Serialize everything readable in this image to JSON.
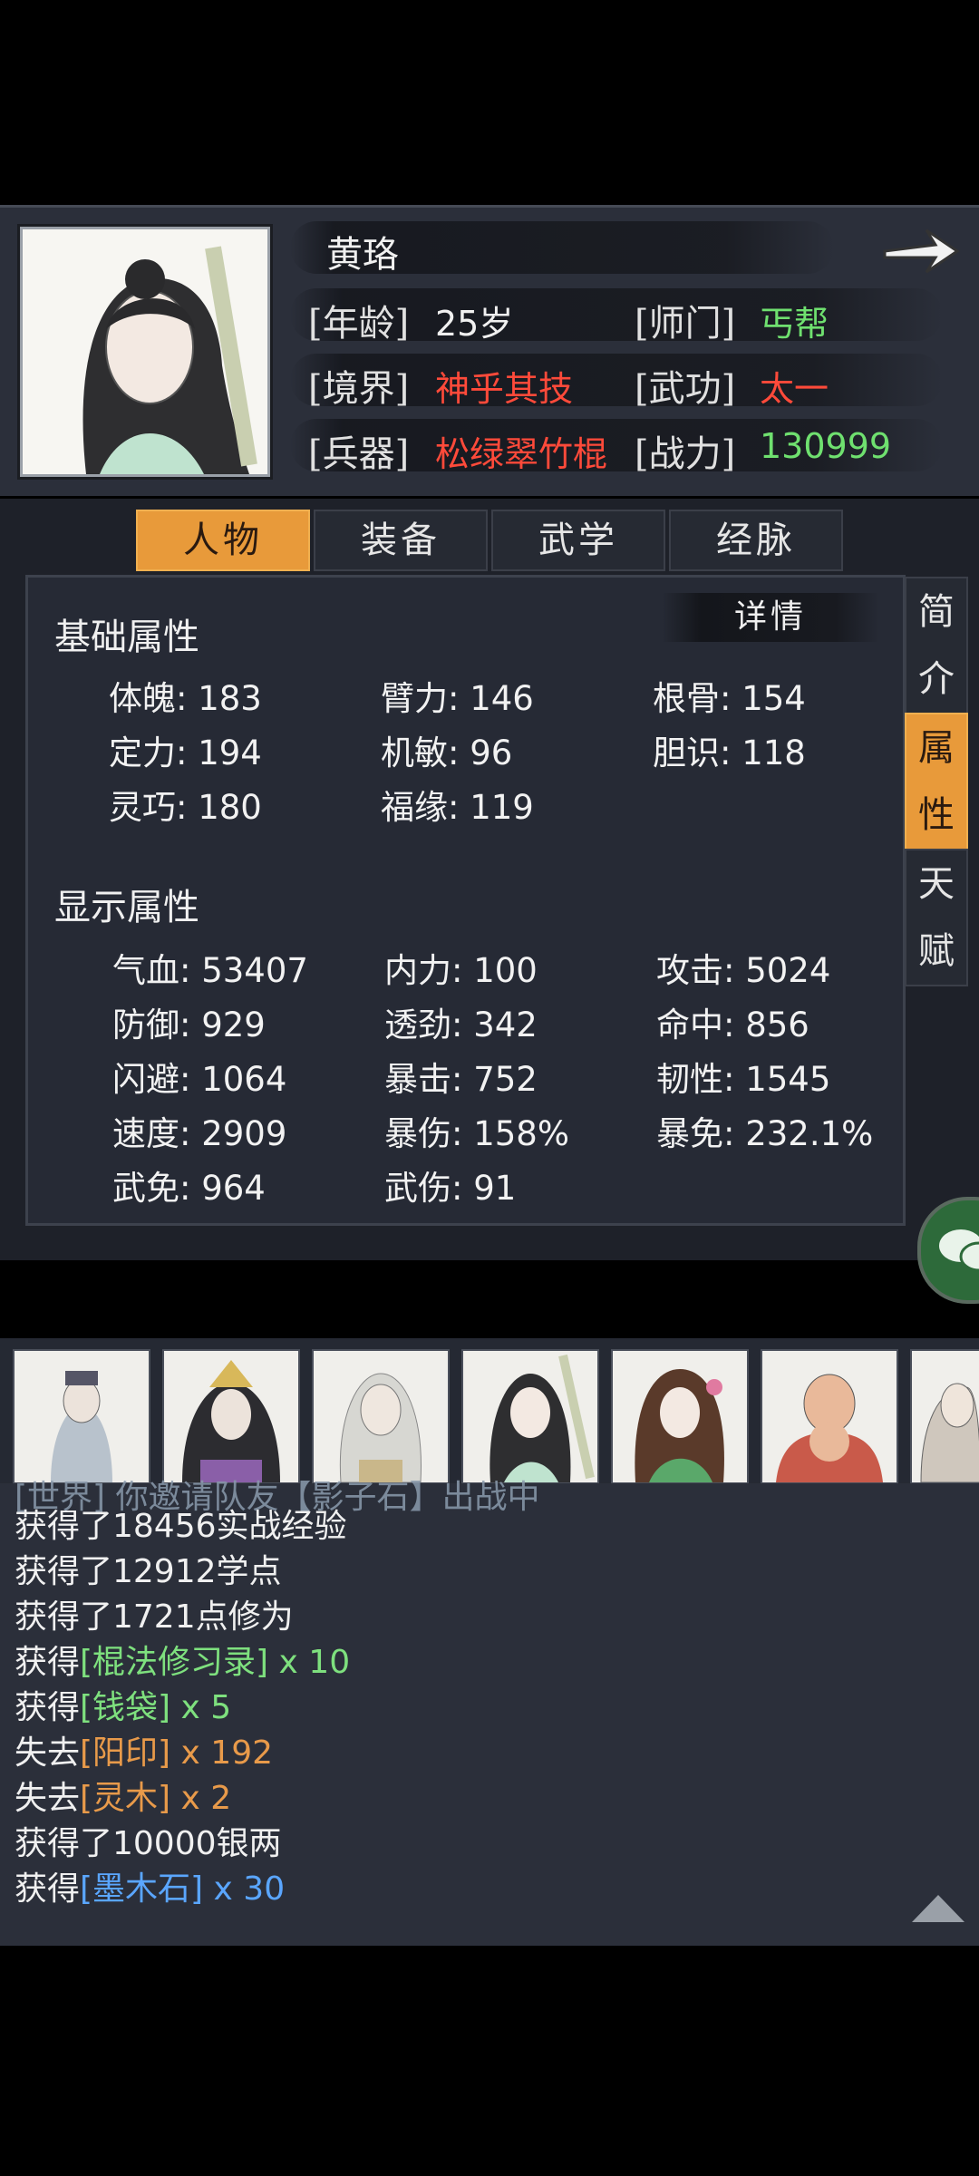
{
  "character": {
    "name": "黄珞",
    "rows": [
      {
        "l1": "[年龄]",
        "v1": "25岁",
        "l2": "[师门]",
        "v2": "丐帮"
      },
      {
        "l1": "[境界]",
        "v1": "神乎其技",
        "l2": "[武功]",
        "v2": "太一"
      },
      {
        "l1": "[兵器]",
        "v1": "松绿翠竹棍",
        "l2": "[战力]",
        "v2": "130999"
      }
    ]
  },
  "tabs": [
    "人物",
    "装备",
    "武学",
    "经脉"
  ],
  "side_tabs": [
    "简介",
    "属性",
    "天赋"
  ],
  "detail_label": "详情",
  "basic": {
    "title": "基础属性",
    "stats": [
      "体魄: 183",
      "臂力: 146",
      "根骨: 154",
      "定力: 194",
      "机敏: 96",
      "胆识: 118",
      "灵巧: 180",
      "福缘: 119"
    ]
  },
  "display": {
    "title": "显示属性",
    "stats": [
      "气血: 53407",
      "内力: 100",
      "攻击: 5024",
      "防御: 929",
      "透劲: 342",
      "命中: 856",
      "闪避: 1064",
      "暴击: 752",
      "韧性: 1545",
      "速度: 2909",
      "暴伤: 158%",
      "暴免: 232.1%",
      "武免: 964",
      "武伤: 91"
    ]
  },
  "log": {
    "partial": "[世界] 你邀请队友【影子石】出战中",
    "l1": "获得了18456实战经验",
    "l2": "获得了12912学点",
    "l3": "获得了1721点修为",
    "l4a": "获得",
    "l4b": "[棍法修习录]",
    "l4c": " x 10",
    "l5a": "获得",
    "l5b": "[钱袋]",
    "l5c": " x 5",
    "l6a": "失去",
    "l6b": "[阳印]",
    "l6c": " x 192",
    "l7a": "失去",
    "l7b": "[灵木]",
    "l7c": " x 2",
    "l8": "获得了10000银两",
    "l9a": "获得",
    "l9b": "[墨木石]",
    "l9c": " x 30"
  },
  "colors": {
    "accent": "#e89a3a",
    "green": "#6fe06f",
    "red": "#ff4a3a",
    "blue": "#5aa6ff",
    "orange": "#e89a4a"
  }
}
